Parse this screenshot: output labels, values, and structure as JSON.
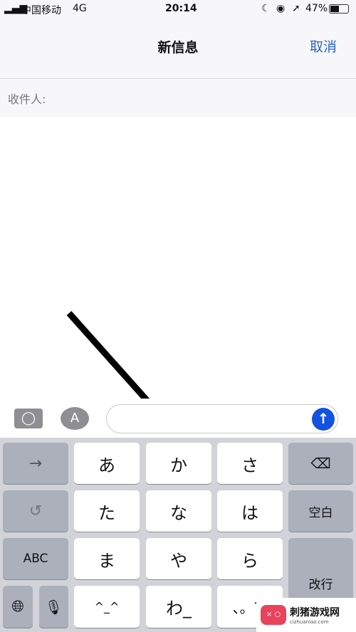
{
  "status": {
    "carrier": "中国移动",
    "network": "4G",
    "time": "20:14",
    "battery": "47%"
  },
  "nav": {
    "title": "新信息",
    "cancel": "取消"
  },
  "recipient": {
    "label": "收件人:"
  },
  "compose": {
    "placeholder": "",
    "accent": "#1453e0"
  },
  "keyboard": {
    "rows": [
      [
        "→",
        "あ",
        "か",
        "さ",
        "delete"
      ],
      [
        "undo",
        "た",
        "な",
        "は",
        "空白"
      ],
      [
        "ABC",
        "ま",
        "や",
        "ら",
        "改行"
      ],
      [
        "globe",
        "mic",
        "^^",
        "わ",
        "、。?!"
      ]
    ],
    "labels": {
      "next": "→",
      "a": "あ",
      "ka": "か",
      "sa": "さ",
      "ta": "た",
      "na": "な",
      "ha": "は",
      "space": "空白",
      "abc": "ABC",
      "ma": "ま",
      "ya": "や",
      "ra": "ら",
      "return": "改行",
      "kaomoji": "^_^",
      "wa": "わ_",
      "punct": "、。?!"
    }
  },
  "watermark": {
    "name": "刺猪游戏网",
    "url": "cizhuanlao.com"
  }
}
